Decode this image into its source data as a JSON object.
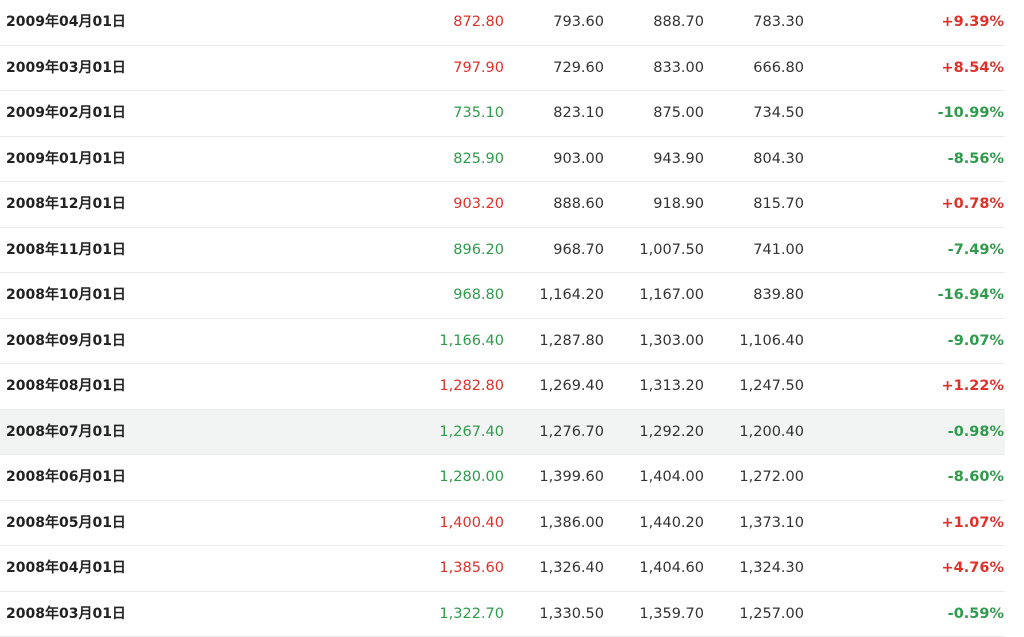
{
  "colors": {
    "up": "#e0302a",
    "down": "#2f9a4c",
    "text": "#333333",
    "row_highlight": "#f2f4f3"
  },
  "rows": [
    {
      "date": "2009年04月01日",
      "close": "872.80",
      "open": "793.60",
      "high": "888.70",
      "low": "783.30",
      "change": "+9.39%",
      "direction": "up"
    },
    {
      "date": "2009年03月01日",
      "close": "797.90",
      "open": "729.60",
      "high": "833.00",
      "low": "666.80",
      "change": "+8.54%",
      "direction": "up"
    },
    {
      "date": "2009年02月01日",
      "close": "735.10",
      "open": "823.10",
      "high": "875.00",
      "low": "734.50",
      "change": "-10.99%",
      "direction": "down"
    },
    {
      "date": "2009年01月01日",
      "close": "825.90",
      "open": "903.00",
      "high": "943.90",
      "low": "804.30",
      "change": "-8.56%",
      "direction": "down"
    },
    {
      "date": "2008年12月01日",
      "close": "903.20",
      "open": "888.60",
      "high": "918.90",
      "low": "815.70",
      "change": "+0.78%",
      "direction": "up"
    },
    {
      "date": "2008年11月01日",
      "close": "896.20",
      "open": "968.70",
      "high": "1,007.50",
      "low": "741.00",
      "change": "-7.49%",
      "direction": "down"
    },
    {
      "date": "2008年10月01日",
      "close": "968.80",
      "open": "1,164.20",
      "high": "1,167.00",
      "low": "839.80",
      "change": "-16.94%",
      "direction": "down"
    },
    {
      "date": "2008年09月01日",
      "close": "1,166.40",
      "open": "1,287.80",
      "high": "1,303.00",
      "low": "1,106.40",
      "change": "-9.07%",
      "direction": "down"
    },
    {
      "date": "2008年08月01日",
      "close": "1,282.80",
      "open": "1,269.40",
      "high": "1,313.20",
      "low": "1,247.50",
      "change": "+1.22%",
      "direction": "up"
    },
    {
      "date": "2008年07月01日",
      "close": "1,267.40",
      "open": "1,276.70",
      "high": "1,292.20",
      "low": "1,200.40",
      "change": "-0.98%",
      "direction": "down",
      "highlighted": true
    },
    {
      "date": "2008年06月01日",
      "close": "1,280.00",
      "open": "1,399.60",
      "high": "1,404.00",
      "low": "1,272.00",
      "change": "-8.60%",
      "direction": "down"
    },
    {
      "date": "2008年05月01日",
      "close": "1,400.40",
      "open": "1,386.00",
      "high": "1,440.20",
      "low": "1,373.10",
      "change": "+1.07%",
      "direction": "up"
    },
    {
      "date": "2008年04月01日",
      "close": "1,385.60",
      "open": "1,326.40",
      "high": "1,404.60",
      "low": "1,324.30",
      "change": "+4.76%",
      "direction": "up"
    },
    {
      "date": "2008年03月01日",
      "close": "1,322.70",
      "open": "1,330.50",
      "high": "1,359.70",
      "low": "1,257.00",
      "change": "-0.59%",
      "direction": "down"
    }
  ]
}
